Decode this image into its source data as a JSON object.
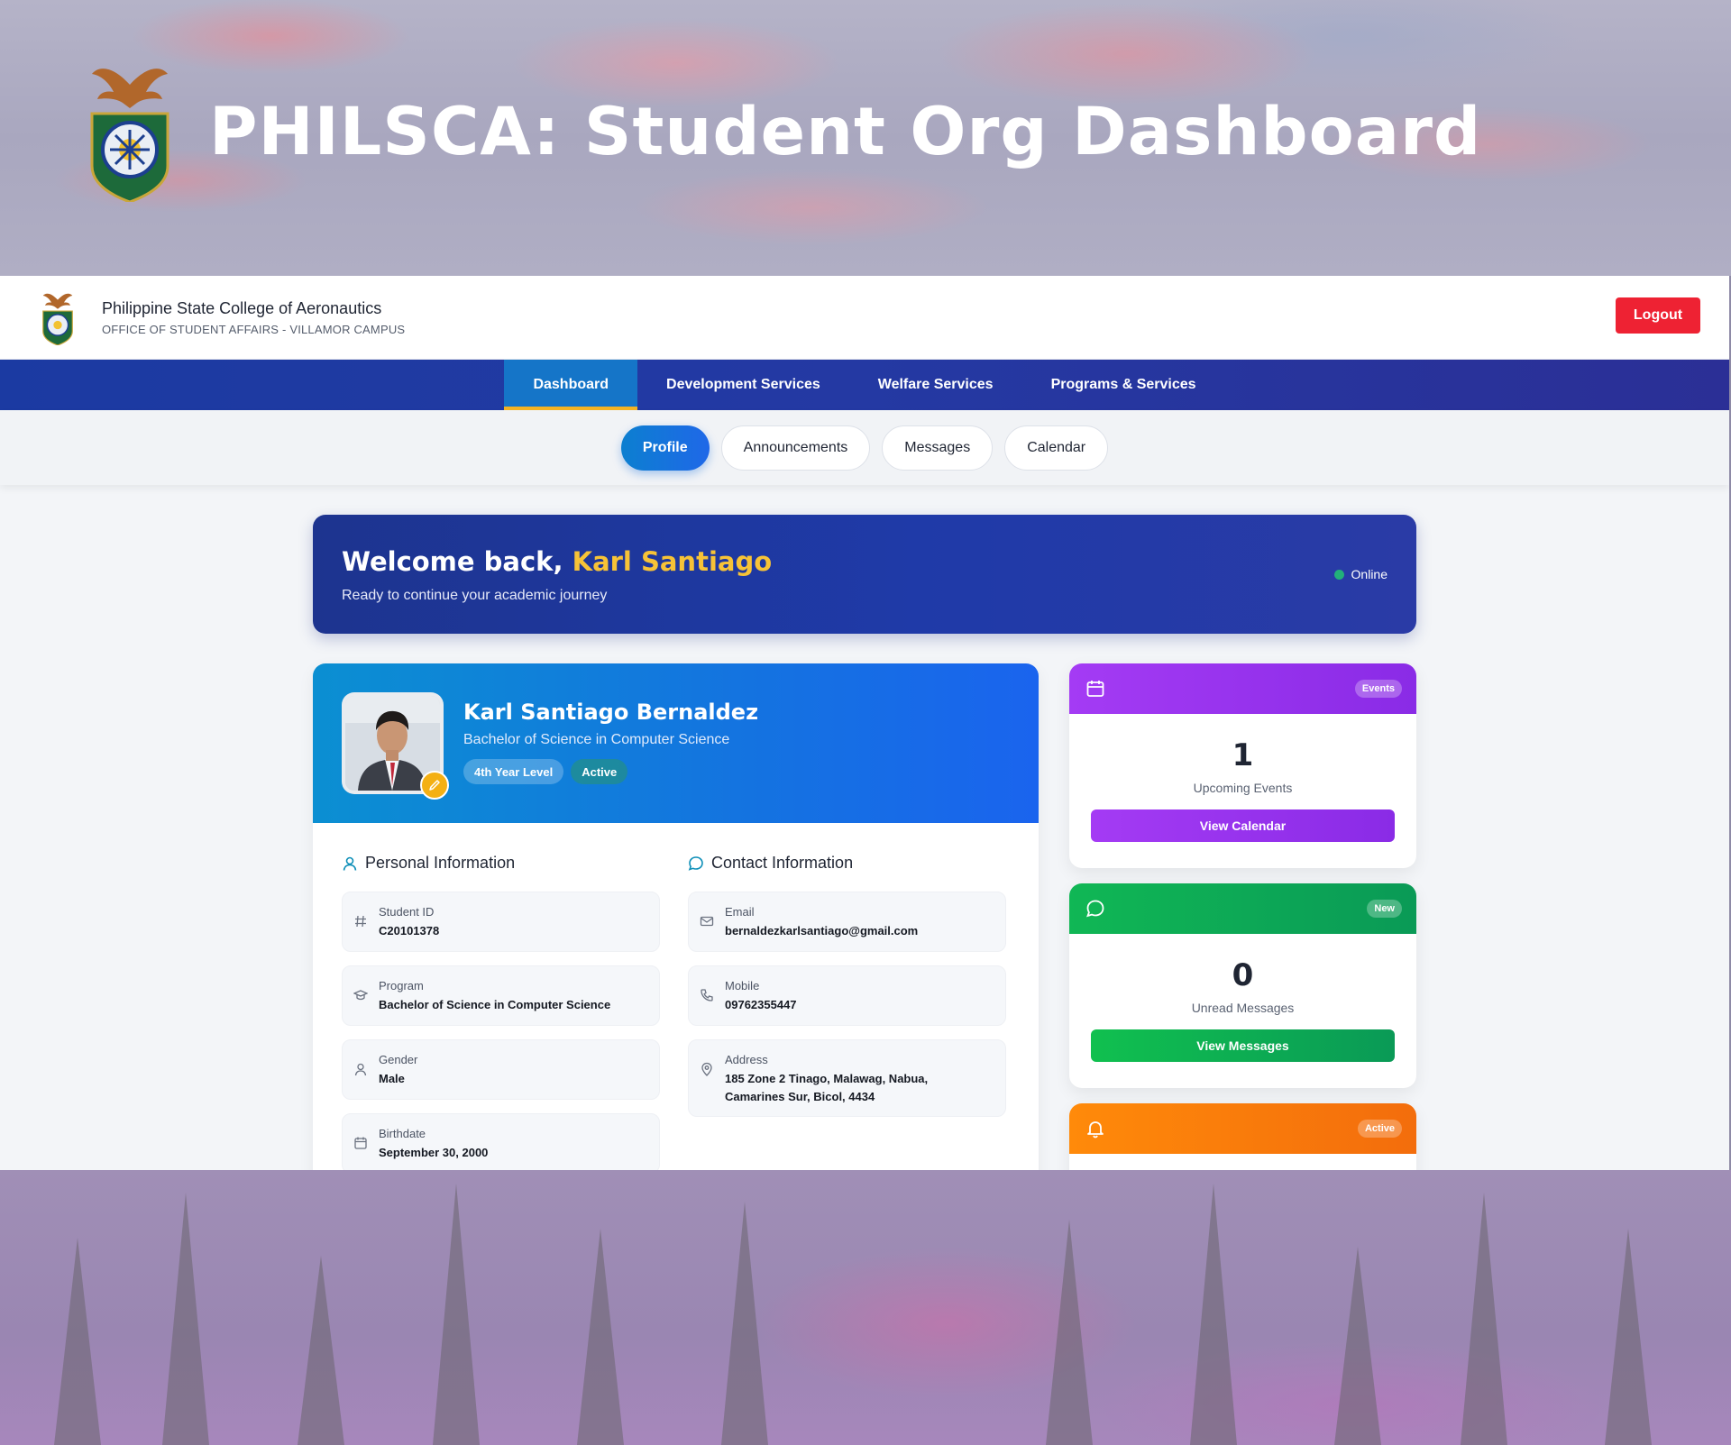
{
  "hero": {
    "title": "PHILSCA: Student Org Dashboard"
  },
  "header": {
    "org_name": "Philippine State College of Aeronautics",
    "org_sub": "OFFICE OF STUDENT AFFAIRS - VILLAMOR CAMPUS",
    "logout_label": "Logout"
  },
  "nav": {
    "items": [
      {
        "label": "Dashboard",
        "active": true
      },
      {
        "label": "Development Services"
      },
      {
        "label": "Welfare Services"
      },
      {
        "label": "Programs & Services"
      }
    ]
  },
  "subnav": {
    "items": [
      {
        "label": "Profile",
        "active": true
      },
      {
        "label": "Announcements"
      },
      {
        "label": "Messages"
      },
      {
        "label": "Calendar"
      }
    ]
  },
  "welcome": {
    "greeting": "Welcome back,",
    "name": "Karl Santiago",
    "subtitle": "Ready to continue your academic journey",
    "status": "Online"
  },
  "profile": {
    "full_name": "Karl Santiago Bernaldez",
    "program": "Bachelor of Science in Computer Science",
    "level_chip": "4th Year Level",
    "status_chip": "Active"
  },
  "personal": {
    "title": "Personal Information",
    "fields": [
      {
        "label": "Student ID",
        "value": "C20101378",
        "icon": "hash-icon"
      },
      {
        "label": "Program",
        "value": "Bachelor of Science in Computer Science",
        "icon": "graduation-cap-icon"
      },
      {
        "label": "Gender",
        "value": "Male",
        "icon": "user-icon"
      },
      {
        "label": "Birthdate",
        "value": "September 30, 2000",
        "icon": "calendar-icon"
      }
    ]
  },
  "contact": {
    "title": "Contact Information",
    "fields": [
      {
        "label": "Email",
        "value": "bernaldezkarlsantiago@gmail.com",
        "icon": "mail-icon"
      },
      {
        "label": "Mobile",
        "value": "09762355447",
        "icon": "phone-icon"
      },
      {
        "label": "Address",
        "value": "185 Zone 2 Tinago, Malawag, Nabua, Camarines Sur, Bicol, 4434",
        "icon": "map-pin-icon"
      }
    ]
  },
  "stats": {
    "events": {
      "badge": "Events",
      "count": "1",
      "label": "Upcoming Events",
      "button": "View Calendar",
      "color": "#9b35f0"
    },
    "messages": {
      "badge": "New",
      "count": "0",
      "label": "Unread Messages",
      "button": "View Messages",
      "color": "#0fae55"
    },
    "announcements": {
      "badge": "Active",
      "color": "#fb7d0b"
    }
  },
  "colors": {
    "nav": "#1b3aa2",
    "accent": "#f4b323",
    "logout": "#ee2233",
    "welcome_name": "#f7c337"
  }
}
